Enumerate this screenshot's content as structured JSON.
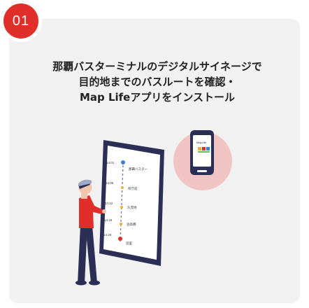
{
  "step": {
    "number": "01"
  },
  "description": {
    "lines": [
      "那覇バスターミナルのデジタルサイネージで",
      "目的地までのバスルートを確認・",
      "Map Lifeアプリをインストール"
    ]
  },
  "signage": {
    "stops": [
      {
        "time": "14:01",
        "label": "那覇バスター"
      },
      {
        "time": "14:06",
        "label": "県庁前"
      },
      {
        "time": "14:12",
        "label": "久茂地"
      },
      {
        "time": "14:18",
        "label": "泊高橋"
      },
      {
        "time": "14:25",
        "label": "首里"
      }
    ]
  },
  "phone": {
    "app_label": "MapLife"
  },
  "colors": {
    "accent": "#e02f2a",
    "card": "#f1f1f1",
    "screen_frame": "#2b2f55",
    "bubble": "#efc4c2"
  }
}
